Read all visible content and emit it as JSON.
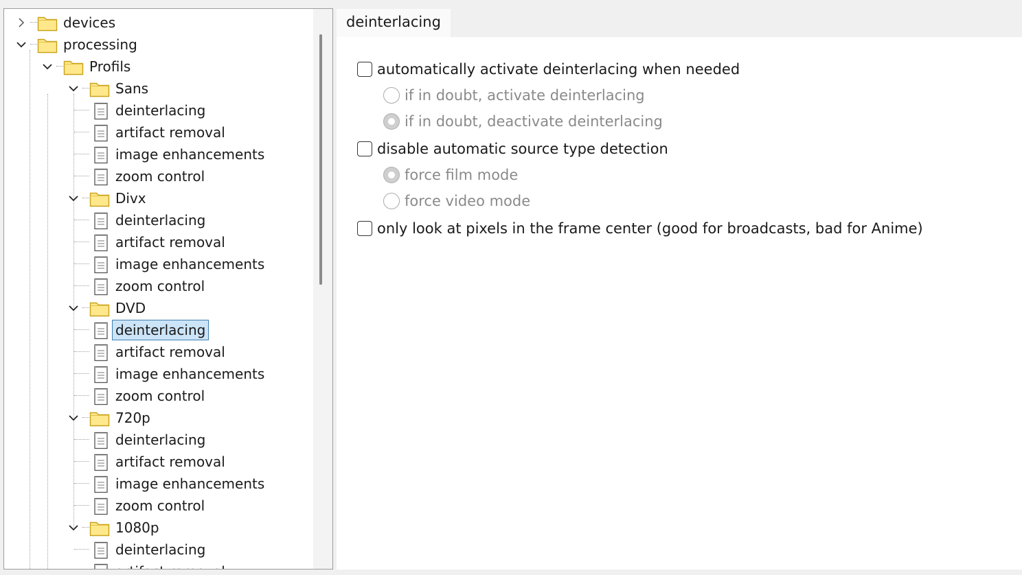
{
  "tree": {
    "items": [
      {
        "label": "devices",
        "icon": "folder-icon",
        "expanded": false
      },
      {
        "label": "processing",
        "icon": "folder-icon",
        "expanded": true
      },
      {
        "label": "Profils",
        "icon": "folder-icon",
        "expanded": true
      },
      {
        "label": "Sans",
        "icon": "folder-icon",
        "expanded": true
      },
      {
        "label": "deinterlacing",
        "icon": "page-icon"
      },
      {
        "label": "artifact removal",
        "icon": "page-icon"
      },
      {
        "label": "image enhancements",
        "icon": "page-icon"
      },
      {
        "label": "zoom control",
        "icon": "page-icon"
      },
      {
        "label": "Divx",
        "icon": "folder-icon",
        "expanded": true
      },
      {
        "label": "deinterlacing",
        "icon": "page-icon"
      },
      {
        "label": "artifact removal",
        "icon": "page-icon"
      },
      {
        "label": "image enhancements",
        "icon": "page-icon"
      },
      {
        "label": "zoom control",
        "icon": "page-icon"
      },
      {
        "label": "DVD",
        "icon": "folder-icon",
        "expanded": true
      },
      {
        "label": "deinterlacing",
        "icon": "page-icon",
        "selected": true
      },
      {
        "label": "artifact removal",
        "icon": "page-icon"
      },
      {
        "label": "image enhancements",
        "icon": "page-icon"
      },
      {
        "label": "zoom control",
        "icon": "page-icon"
      },
      {
        "label": "720p",
        "icon": "folder-icon",
        "expanded": true
      },
      {
        "label": "deinterlacing",
        "icon": "page-icon"
      },
      {
        "label": "artifact removal",
        "icon": "page-icon"
      },
      {
        "label": "image enhancements",
        "icon": "page-icon"
      },
      {
        "label": "zoom control",
        "icon": "page-icon"
      },
      {
        "label": "1080p",
        "icon": "folder-icon",
        "expanded": true
      },
      {
        "label": "deinterlacing",
        "icon": "page-icon"
      },
      {
        "label": "artifact removal",
        "icon": "page-icon"
      }
    ]
  },
  "panel": {
    "tab_label": "deinterlacing",
    "options": {
      "auto_activate": {
        "label": "automatically activate deinterlacing when needed",
        "checked": false
      },
      "doubt_activate": {
        "label": "if in doubt, activate deinterlacing",
        "checked": false,
        "enabled": false
      },
      "doubt_deactivate": {
        "label": "if in doubt, deactivate deinterlacing",
        "checked": true,
        "enabled": false
      },
      "disable_detection": {
        "label": "disable automatic source type detection",
        "checked": false
      },
      "force_film": {
        "label": "force film mode",
        "checked": true,
        "enabled": false
      },
      "force_video": {
        "label": "force video mode",
        "checked": false,
        "enabled": false
      },
      "frame_center": {
        "label": "only look at pixels in the frame center  (good for broadcasts, bad for Anime)",
        "checked": false
      }
    }
  },
  "colors": {
    "selection_bg": "#cce4f7",
    "selection_border": "#3c7fb1",
    "folder_fill": "#ffe88c",
    "folder_stroke": "#c9a21b",
    "disabled_text": "#8a8a8a"
  }
}
